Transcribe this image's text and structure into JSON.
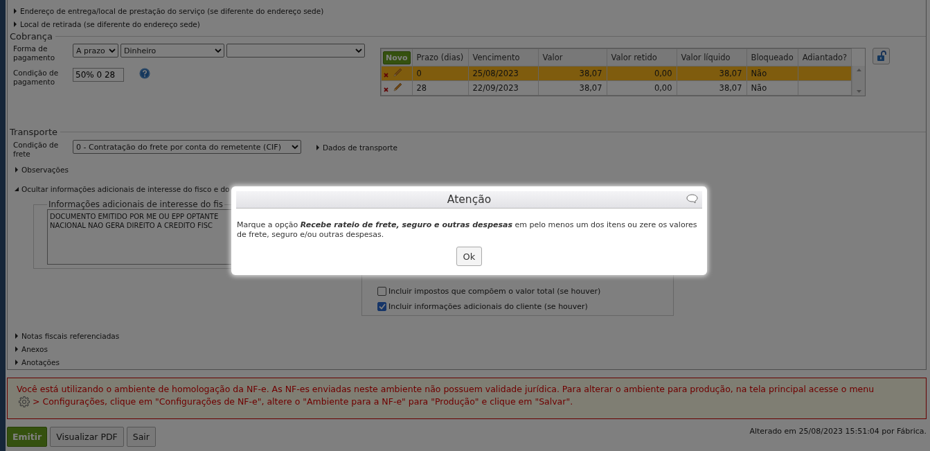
{
  "sections_top": [
    {
      "label": "Endereço de entrega/local de prestação do serviço (se diferente do endereço sede)",
      "expanded": false
    },
    {
      "label": "Local de retirada (se diferente do endereço sede)",
      "expanded": false
    }
  ],
  "cobranca": {
    "title": "Cobrança",
    "payment_form_label": "Forma de pagamento",
    "payment_selects": [
      "A prazo",
      "Dinheiro"
    ],
    "payment_condition_label": "Condição de pagamento",
    "payment_condition_value": "50% 0 28"
  },
  "installments": {
    "new_button": "Novo",
    "columns": [
      "Prazo (dias)",
      "Vencimento",
      "Valor",
      "Valor retido",
      "Valor líquido",
      "Bloqueado",
      "Adiantado?"
    ],
    "rows": [
      {
        "selected": true,
        "cells": [
          "0",
          "25/08/2023",
          "38,07",
          "0,00",
          "38,07",
          "Não"
        ]
      },
      {
        "selected": false,
        "cells": [
          "28",
          "22/09/2023",
          "38,07",
          "0,00",
          "38,07",
          "Não"
        ]
      }
    ]
  },
  "transporte": {
    "title": "Transporte",
    "freight_label": "Condição de frete",
    "freight_value": "0 - Contratação do frete por conta do remetente (CIF)",
    "details_link": "Dados de transporte"
  },
  "sections_mid": [
    {
      "label": "Observações",
      "expanded": false
    },
    {
      "label": "Ocultar informações adicionais de interesse do fisco e do",
      "expanded": true
    }
  ],
  "additional_info": {
    "legend": "Informações adicionais de interesse do fis",
    "text_lines": [
      "DOCUMENTO EMITIDO POR ME OU EPP OPTANTE",
      "NACIONAL NAO GERA DIREITO A CREDITO FISC"
    ]
  },
  "options": [
    {
      "label": "Incluir impostos que compõem o valor total (se houver)",
      "checked": false
    },
    {
      "label": "Incluir informações adicionais do cliente (se houver)",
      "checked": true
    }
  ],
  "sections_bottom": [
    {
      "label": "Notas fiscais referenciadas",
      "expanded": false
    },
    {
      "label": "Anexos",
      "expanded": false
    },
    {
      "label": "Anotações",
      "expanded": false
    }
  ],
  "warning": {
    "line_1": "Você está utilizando o ambiente de homologação da NF-e. As NF-es enviadas neste ambiente não possuem validade jurídica. Para alterar o ambiente para produção, na tela principal acesse o menu",
    "line_2": "> Configurações, clique em \"Configurações de NF-e\", altere o \"Ambiente para a NF-e\" para \"Produção\" e clique em \"Salvar\"."
  },
  "buttons": [
    {
      "label": "Emitir",
      "kind": "primary"
    },
    {
      "label": "Visualizar PDF",
      "kind": "default"
    },
    {
      "label": "Sair",
      "kind": "default"
    }
  ],
  "footer": "Alterado em 25/08/2023 15:51:04 por Fábrica.",
  "dialog": {
    "title": "Atenção",
    "message": "Marque a opção **Recebe rateio de frete, seguro e outras despesas** em pelo menos um dos itens ou zere os valores de frete, seguro e/ou outras despesas.",
    "ok_button": "Ok"
  }
}
